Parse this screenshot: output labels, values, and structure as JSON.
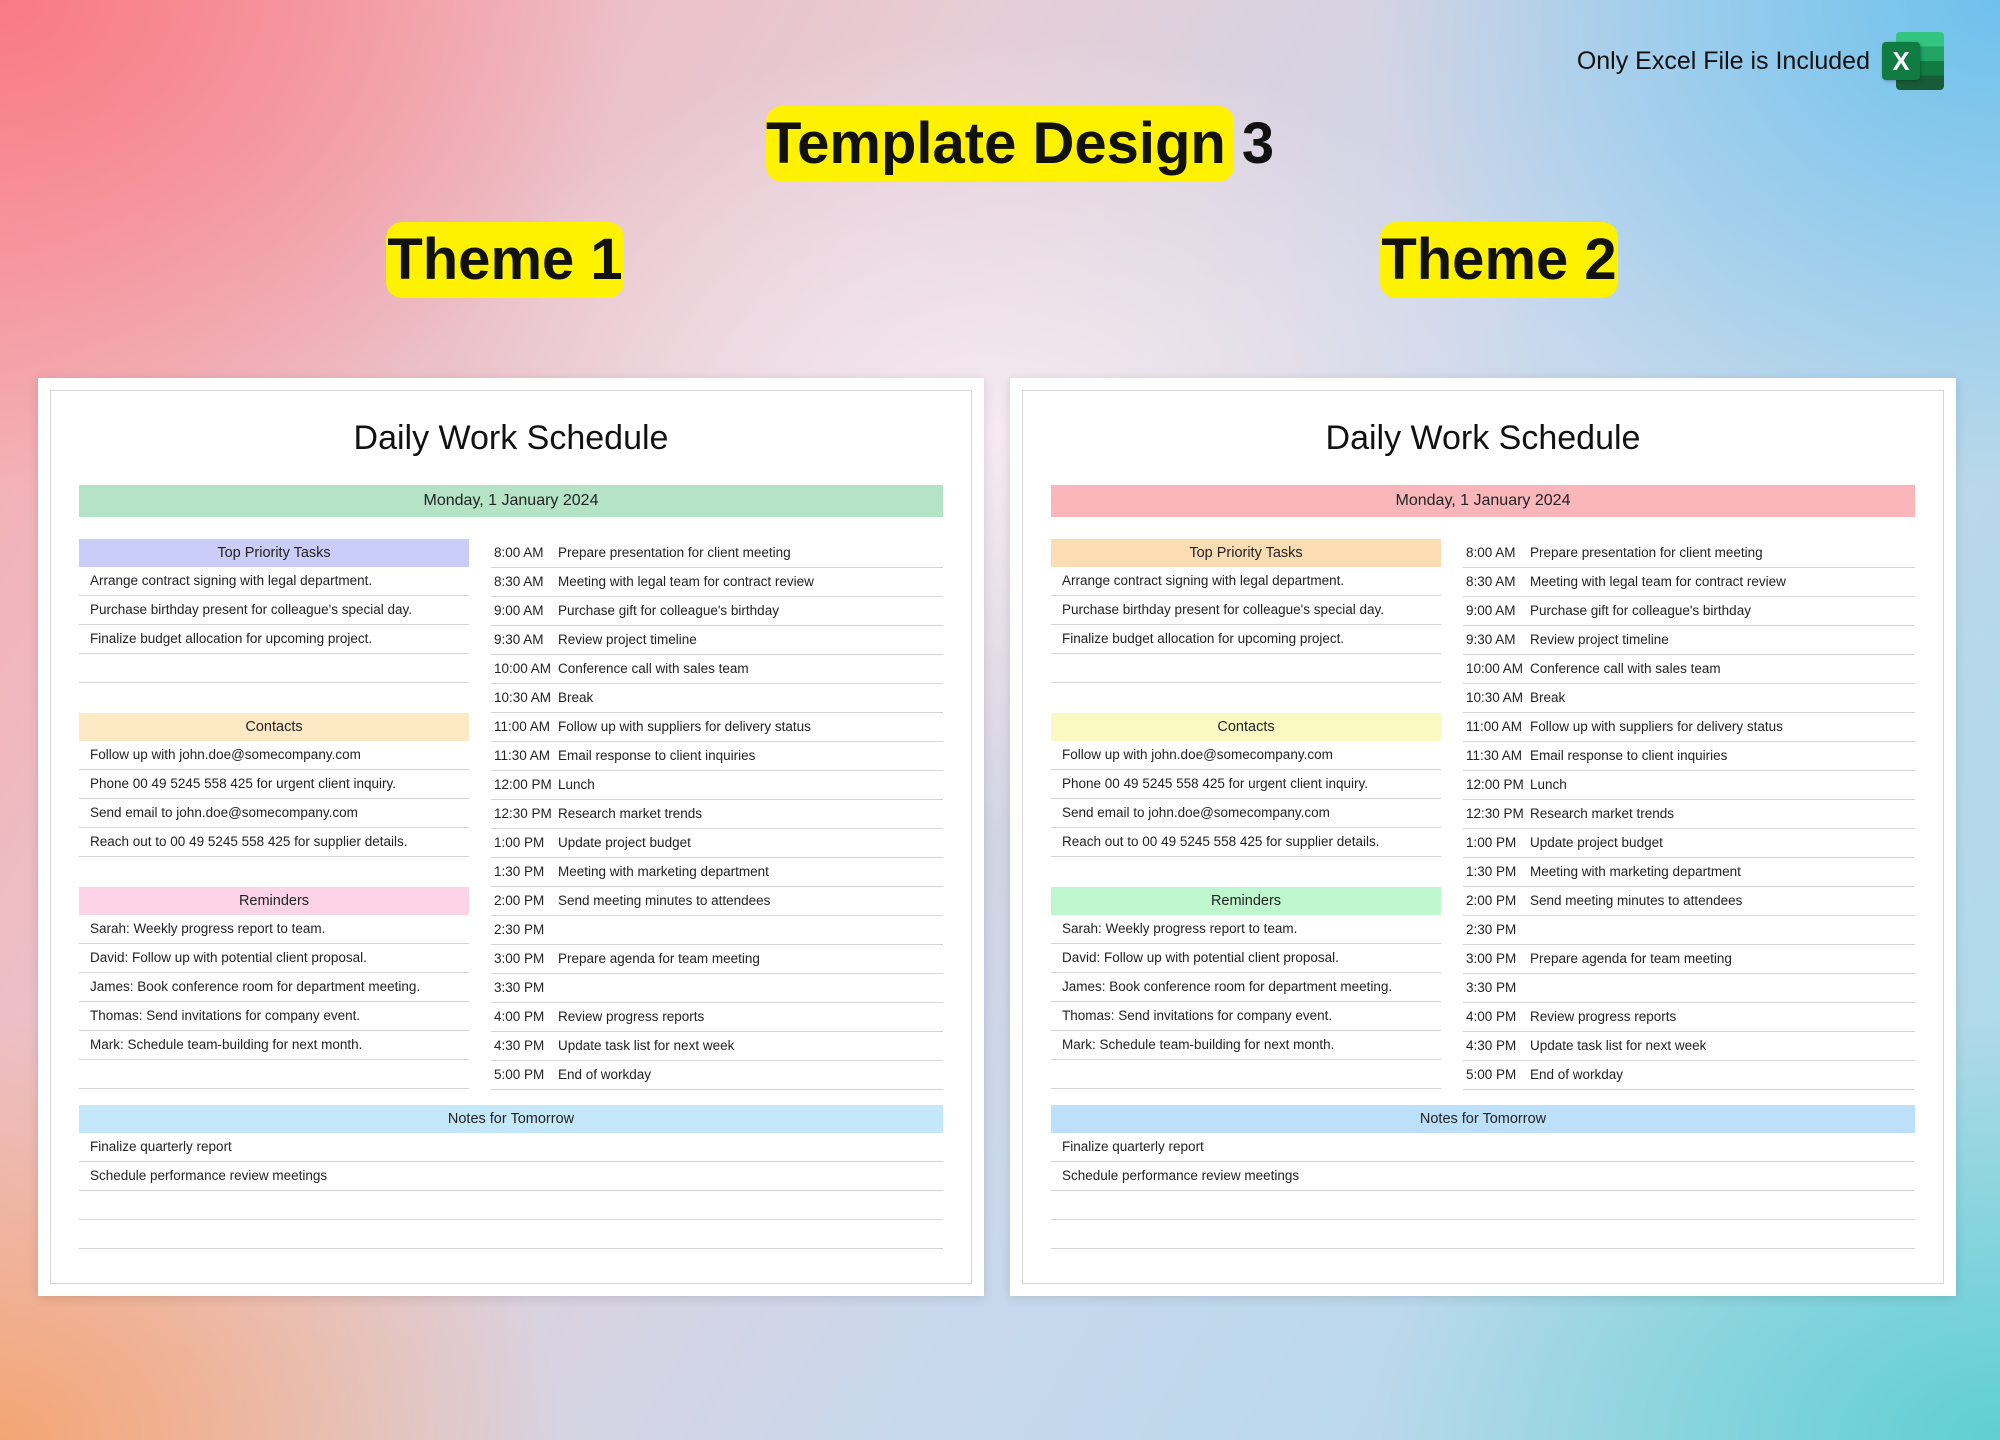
{
  "header": {
    "excel_note": "Only Excel File is Included",
    "excel_icon": "excel-icon",
    "excel_letter": "X",
    "main_title": "Template Design 3",
    "theme1_label": "Theme 1",
    "theme2_label": "Theme 2"
  },
  "doc": {
    "title": "Daily Work Schedule",
    "date": "Monday, 1 January 2024",
    "priority_head": "Top Priority Tasks",
    "priority": [
      "Arrange contract signing with legal department.",
      "Purchase birthday present for colleague's special day.",
      "Finalize budget allocation for upcoming project.",
      ""
    ],
    "contacts_head": "Contacts",
    "contacts": [
      "Follow up with john.doe@somecompany.com",
      "Phone 00 49 5245 558 425 for urgent client inquiry.",
      "Send email to john.doe@somecompany.com",
      "Reach out to 00 49 5245 558 425 for supplier details."
    ],
    "reminders_head": "Reminders",
    "reminders": [
      "Sarah: Weekly progress report to team.",
      "David: Follow up with potential client proposal.",
      "James: Book conference room for department meeting.",
      "Thomas: Send invitations for company event.",
      "Mark: Schedule team-building for next month.",
      ""
    ],
    "schedule": [
      {
        "time": "8:00 AM",
        "activity": "Prepare presentation for client meeting"
      },
      {
        "time": "8:30 AM",
        "activity": "Meeting with legal team for contract review"
      },
      {
        "time": "9:00 AM",
        "activity": "Purchase gift for colleague's birthday"
      },
      {
        "time": "9:30 AM",
        "activity": "Review project timeline"
      },
      {
        "time": "10:00 AM",
        "activity": "Conference call with sales team"
      },
      {
        "time": "10:30 AM",
        "activity": "Break"
      },
      {
        "time": "11:00 AM",
        "activity": "Follow up with suppliers for delivery status"
      },
      {
        "time": "11:30 AM",
        "activity": "Email response to client inquiries"
      },
      {
        "time": "12:00 PM",
        "activity": "Lunch"
      },
      {
        "time": "12:30 PM",
        "activity": "Research market trends"
      },
      {
        "time": "1:00 PM",
        "activity": "Update project budget"
      },
      {
        "time": "1:30 PM",
        "activity": "Meeting with marketing department"
      },
      {
        "time": "2:00 PM",
        "activity": "Send meeting minutes to attendees"
      },
      {
        "time": "2:30 PM",
        "activity": ""
      },
      {
        "time": "3:00 PM",
        "activity": "Prepare agenda for team meeting"
      },
      {
        "time": "3:30 PM",
        "activity": ""
      },
      {
        "time": "4:00 PM",
        "activity": "Review progress reports"
      },
      {
        "time": "4:30 PM",
        "activity": "Update task list for next week"
      },
      {
        "time": "5:00 PM",
        "activity": "End of workday"
      }
    ],
    "notes_head": "Notes for Tomorrow",
    "notes": [
      "Finalize quarterly report",
      "Schedule performance review meetings",
      "",
      ""
    ]
  },
  "themes": [
    {
      "date": "#b5e3c6",
      "priority": "#c9cdf7",
      "contacts": "#fde9c4",
      "reminders": "#fcd3e7",
      "notes": "#c4e8fa"
    },
    {
      "date": "#fbb6bc",
      "priority": "#fcdcb2",
      "contacts": "#fbf9c2",
      "reminders": "#bff7cf",
      "notes": "#bcdffa"
    }
  ]
}
